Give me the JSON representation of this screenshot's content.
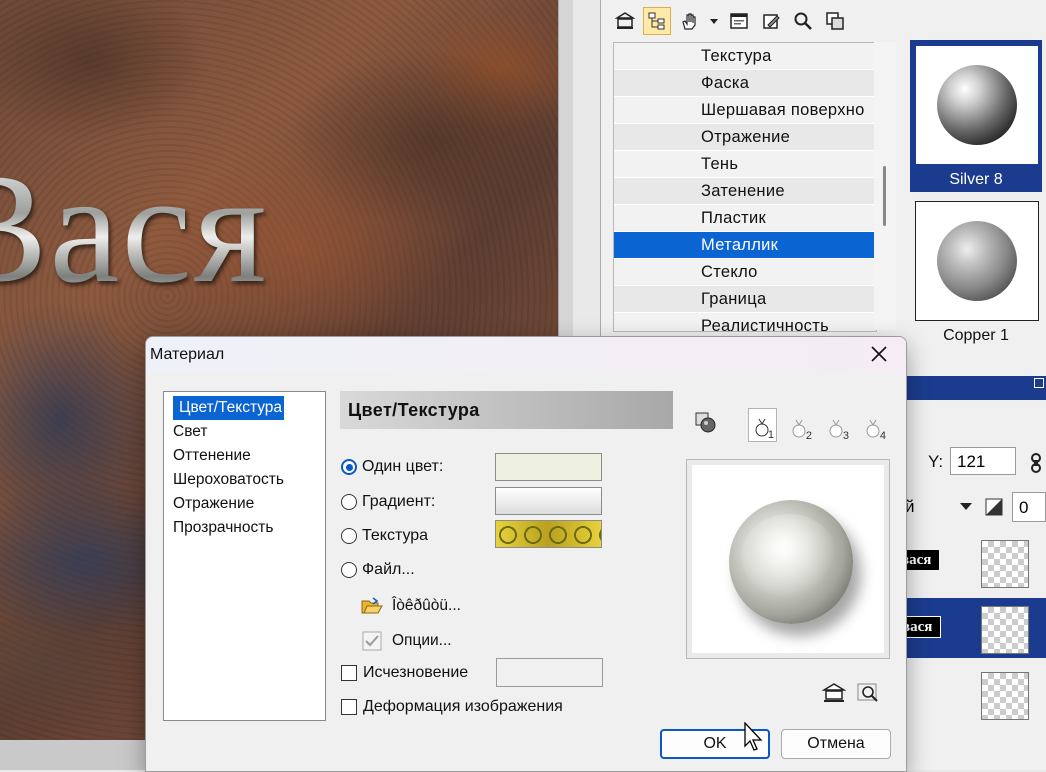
{
  "canvas": {
    "title": "Вася"
  },
  "object_manager": {
    "items": [
      "Текстура",
      "Фаска",
      "Шершавая поверхно",
      "Отражение",
      "Тень",
      "Затенение",
      "Пластик",
      "Металлик",
      "Стекло",
      "Граница",
      "Реалистичность"
    ],
    "selected_index": 7,
    "thumbnails": [
      {
        "label": "Silver 8"
      },
      {
        "label": "Copper 1"
      }
    ]
  },
  "layers_panel": {
    "y_label": "Y:",
    "y_value": "121",
    "mode_value": "й",
    "opacity_value": "0",
    "layers": [
      {
        "name": "вася"
      },
      {
        "name": "вася"
      }
    ]
  },
  "dialog": {
    "title": "Материал",
    "categories": [
      "Цвет/Текстура",
      "Свет",
      "Оттенение",
      "Шероховатость",
      "Отражение",
      "Прозрачность"
    ],
    "section_title": "Цвет/Текстура",
    "options": {
      "solid": "Один цвет:",
      "gradient": "Градиент:",
      "texture": "Текстура",
      "file": "Файл..."
    },
    "browse_label": "Îòêðûòü...",
    "options_label": "Опции...",
    "fade_label": "Исчезновение",
    "warp_label": "Деформация изображения",
    "lights": [
      "1",
      "2",
      "3",
      "4"
    ],
    "ok": "OK",
    "cancel": "Отмена"
  },
  "colors": {
    "selection": "#0a64d2",
    "panel_blue": "#1b3c8e",
    "solid_swatch": "#eef0e0"
  }
}
